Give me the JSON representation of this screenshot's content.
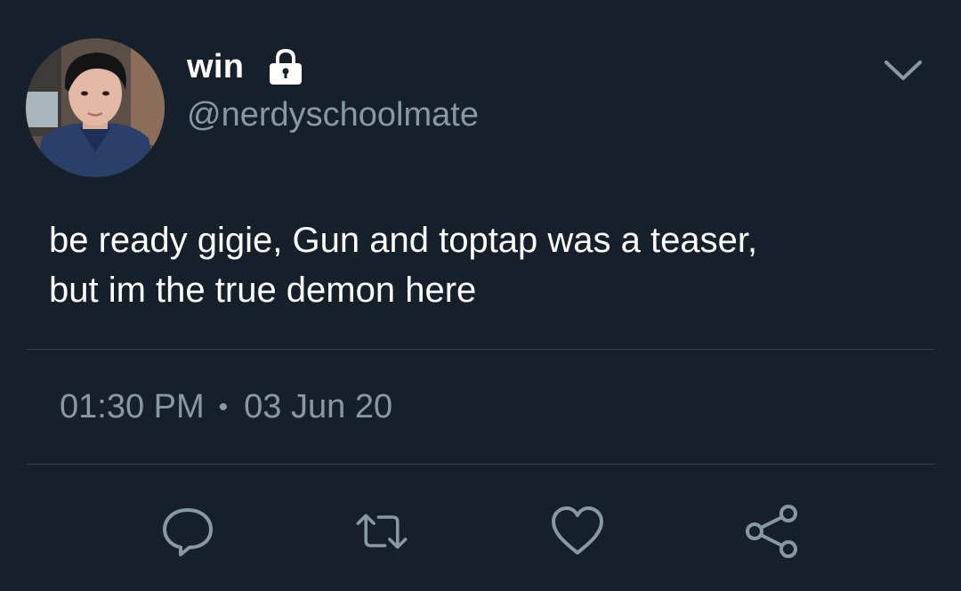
{
  "user": {
    "display_name": "win",
    "handle": "@nerdyschoolmate",
    "protected_icon": "lock-icon",
    "avatar": "profile-photo"
  },
  "tweet": {
    "text_line_1": "be ready gigie, Gun and toptap was a teaser,",
    "text_line_2": "but im the true demon here"
  },
  "meta": {
    "time": "01:30 PM",
    "separator": "•",
    "date": "03 Jun 20"
  },
  "actions": {
    "reply_icon": "reply-icon",
    "retweet_icon": "retweet-icon",
    "like_icon": "heart-icon",
    "share_icon": "share-icon"
  },
  "colors": {
    "background": "#15202b",
    "primary_text": "#ffffff",
    "secondary_text": "#8899a6",
    "divider": "#38444d"
  }
}
